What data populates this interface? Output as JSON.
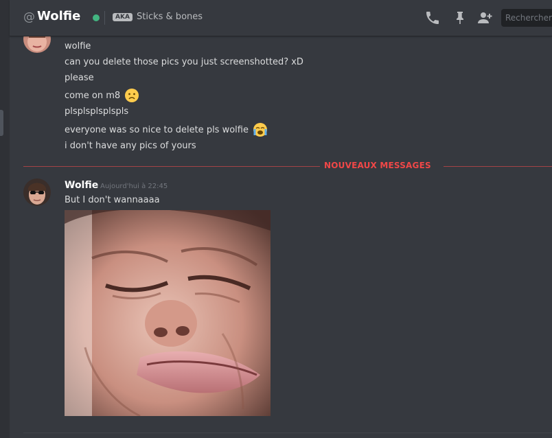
{
  "header": {
    "at_symbol": "@",
    "username": "Wolfie",
    "status_color": "#43b581",
    "aka_label": "AKA",
    "nickname": "Sticks & bones",
    "search_placeholder": "Rechercher",
    "icons": [
      "phone-icon",
      "pin-icon",
      "add-friend-icon"
    ]
  },
  "previous_group": {
    "lines": [
      "wolfie",
      "can you delete those pics you just screenshotted? xD",
      "please",
      "come on m8",
      "plsplsplsplspls",
      "everyone was so nice to delete pls wolfie",
      "i don't have any pics of yours"
    ],
    "emojis": [
      "frowning-face-emoji",
      "loudly-crying-face-emoji"
    ]
  },
  "divider": {
    "label": "NOUVEAUX MESSAGES",
    "color": "#f04747"
  },
  "new_message": {
    "author": "Wolfie",
    "timestamp": "Aujourd'hui à 22:45",
    "text": "But I don't wannaaaa",
    "attachment": "scrunched-face-photo"
  },
  "colors": {
    "background": "#36393f",
    "sidebar": "#2f3136",
    "text": "#dcddde",
    "muted": "#72767d"
  }
}
